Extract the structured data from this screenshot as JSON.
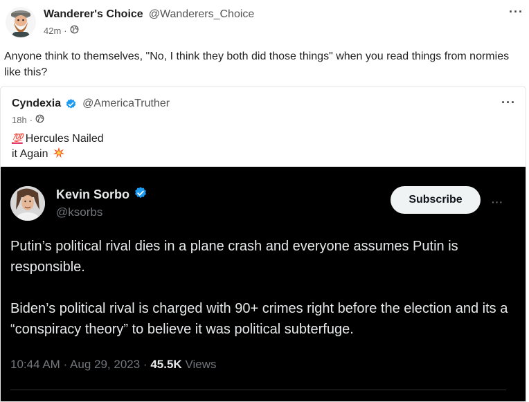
{
  "post": {
    "author_name": "Wanderer's Choice",
    "author_handle": "@Wanderers_Choice",
    "time": "42m",
    "separator": "·",
    "visibility_icon": "globe-icon",
    "text": "Anyone think to themselves, \"No, I think they both did those things\" when you read things from normies like this?"
  },
  "quote": {
    "author_name": "Cyndexia",
    "verified_icon": "verified-badge-icon",
    "author_handle": "@AmericaTruther",
    "time": "18h",
    "separator": "·",
    "visibility_icon": "globe-icon",
    "emoji_1": "💯",
    "text_line_1": "Hercules Nailed",
    "text_line_2": "it Again",
    "emoji_2": "💥"
  },
  "screenshot": {
    "author_name": "Kevin Sorbo",
    "author_handle": "@ksorbs",
    "subscribe_label": "Subscribe",
    "paragraph_1": "Putin’s political rival dies in a plane crash and everyone assumes Putin is responsible.",
    "paragraph_2": "Biden’s political rival is charged with 90+ crimes right before the election and its a “conspiracy theory” to believe it was political subterfuge.",
    "time": "10:44 AM",
    "date": "Aug 29, 2023",
    "views_count": "45.5K",
    "views_label": "Views",
    "separator": "·"
  },
  "colors": {
    "verified_blue": "#1d9bf0",
    "dark_background": "#000000"
  }
}
